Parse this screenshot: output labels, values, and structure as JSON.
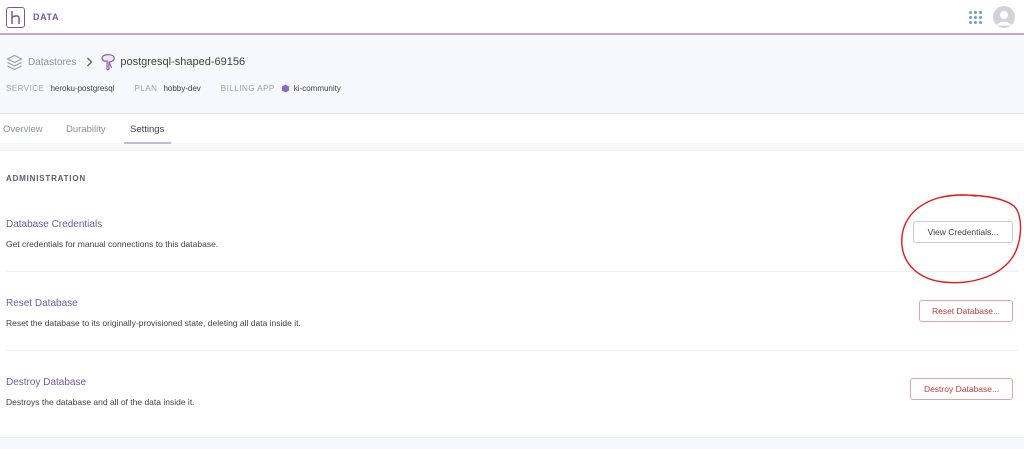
{
  "topbar": {
    "app_name": "DATA",
    "logo_icon": "heroku-logo-icon",
    "apps_icon": "apps-grid-icon",
    "avatar_icon": "user-avatar-icon"
  },
  "breadcrumb": {
    "datastores_label": "Datastores",
    "database_name": "postgresql-shaped-69156"
  },
  "meta": {
    "service_label": "SERVICE",
    "service_value": "heroku-postgresql",
    "plan_label": "PLAN",
    "plan_value": "hobby-dev",
    "billing_label": "BILLING APP",
    "billing_value": "ki-community"
  },
  "tabs": [
    {
      "label": "Overview",
      "active": false
    },
    {
      "label": "Durability",
      "active": false
    },
    {
      "label": "Settings",
      "active": true
    }
  ],
  "administration": {
    "title": "ADMINISTRATION",
    "rows": [
      {
        "title": "Database Credentials",
        "description": "Get credentials for manual connections to this database.",
        "button": "View Credentials..."
      },
      {
        "title": "Reset Database",
        "description": "Reset the database to its originally-provisioned state, deleting all data inside it.",
        "button": "Reset Database..."
      },
      {
        "title": "Destroy Database",
        "description": "Destroys the database and all of the data inside it.",
        "button": "Destroy Database..."
      }
    ]
  },
  "colors": {
    "brand_purple": "#79589f",
    "danger_red": "#c43c3c",
    "annotation_red": "#e0191c"
  }
}
